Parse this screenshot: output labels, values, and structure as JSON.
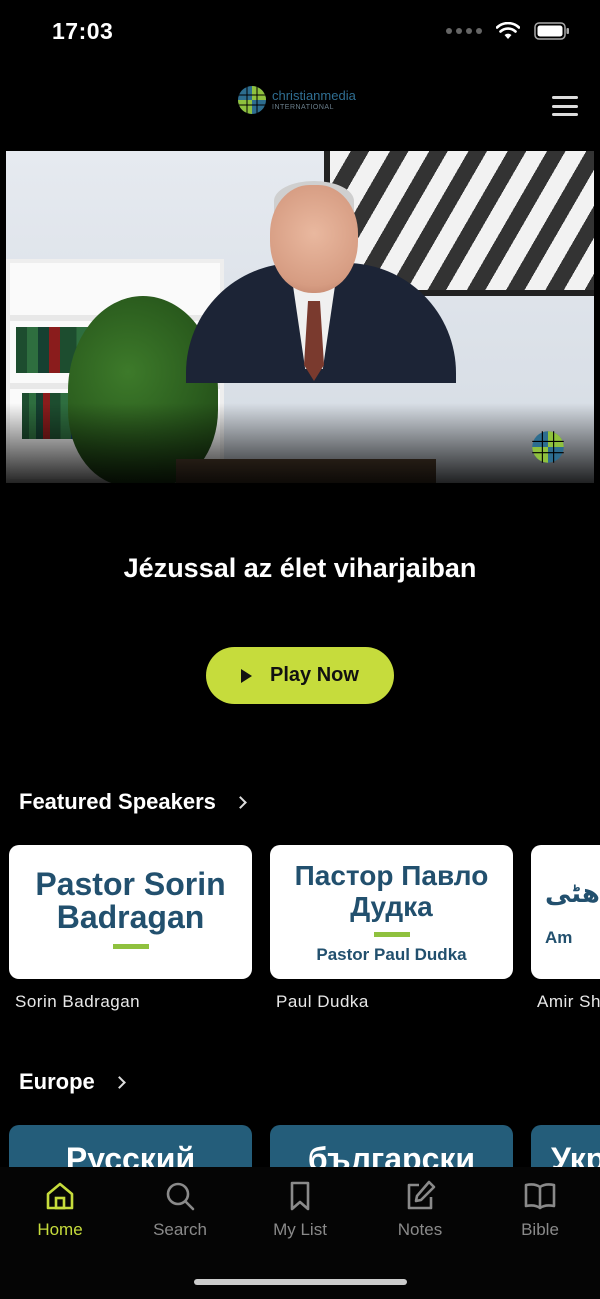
{
  "status": {
    "time": "17:03"
  },
  "header": {
    "logo_main": "christianmedia",
    "logo_sub": "INTERNATIONAL"
  },
  "hero": {
    "title": "Jézussal az élet viharjaiban",
    "play_label": "Play Now"
  },
  "featured": {
    "title": "Featured Speakers",
    "cards": [
      {
        "thumb_big": "Pastor Sorin Badragan",
        "thumb_small": "",
        "name": "Sorin Badragan"
      },
      {
        "thumb_big": "Пастор Павло Дудка",
        "thumb_small": "Pastor Paul Dudka",
        "name": "Paul Dudka"
      },
      {
        "thumb_big": "ھٹی-",
        "thumb_small": "Am",
        "name": "Amir Sh"
      }
    ]
  },
  "europe": {
    "title": "Europe",
    "cards": [
      {
        "label": "Русский"
      },
      {
        "label": "български"
      },
      {
        "label": "Укр"
      }
    ]
  },
  "tabs": [
    {
      "label": "Home",
      "icon": "home-icon",
      "active": true
    },
    {
      "label": "Search",
      "icon": "search-icon",
      "active": false
    },
    {
      "label": "My List",
      "icon": "bookmark-icon",
      "active": false
    },
    {
      "label": "Notes",
      "icon": "edit-note-icon",
      "active": false
    },
    {
      "label": "Bible",
      "icon": "book-icon",
      "active": false
    }
  ],
  "colors": {
    "accent": "#c6dc3c",
    "card_text": "#22506e",
    "europe_card": "#245d7a"
  }
}
